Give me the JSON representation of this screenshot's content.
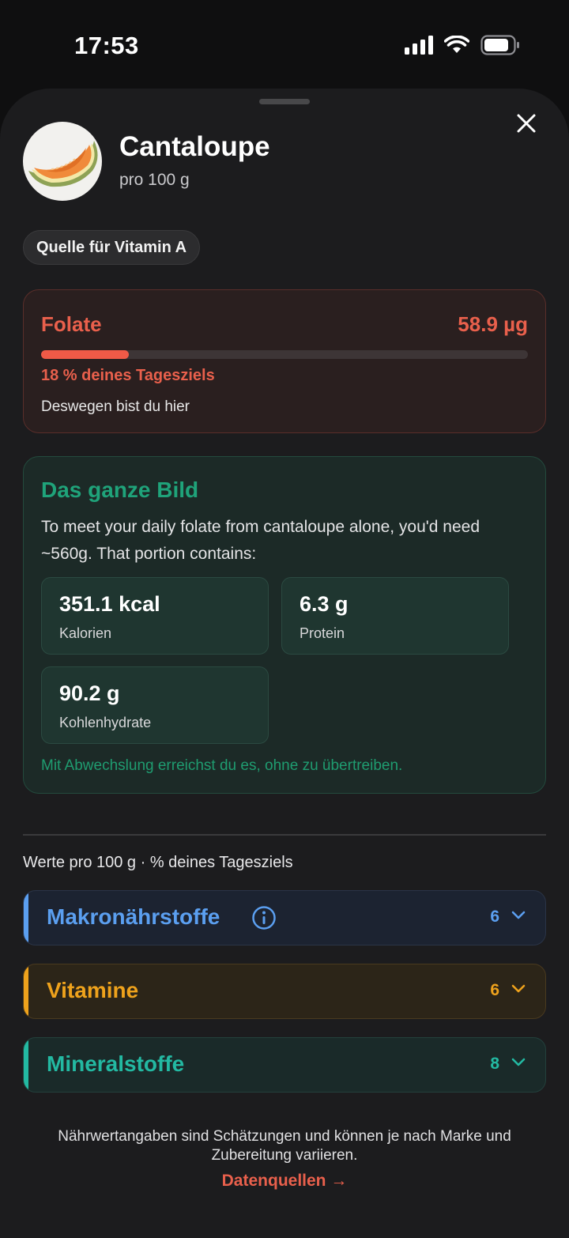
{
  "status_bar": {
    "time": "17:53"
  },
  "food": {
    "name": "Cantaloupe",
    "serving": "pro 100 g",
    "image_icon": "cantaloupe-slice"
  },
  "source_chip": "Quelle für Vitamin A",
  "focus_nutrient": {
    "name": "Folate",
    "value": "58.9 µg",
    "percent_text": "18 % deines Tagesziels",
    "progress": 0.18,
    "note": "Deswegen bist du hier",
    "color": "#e9604c"
  },
  "big_picture": {
    "title": "Das ganze Bild",
    "description": "To meet your daily folate from cantaloupe alone, you'd need ~560g. That portion contains:",
    "stats": [
      {
        "value": "351.1 kcal",
        "label": "Kalorien"
      },
      {
        "value": "6.3 g",
        "label": "Protein"
      },
      {
        "value": "90.2 g",
        "label": "Kohlenhydrate"
      }
    ],
    "footer": "Mit Abwechslung erreichst du es, ohne zu übertreiben.",
    "color": "#1fa37a"
  },
  "values_caption": "Werte pro 100 g · % deines Tagesziels",
  "sections": [
    {
      "label": "Makronährstoffe",
      "count": "6",
      "color": "#5b9ff0",
      "bg": "#1c2331",
      "border": "#2a3447",
      "has_info": true
    },
    {
      "label": "Vitamine",
      "count": "6",
      "color": "#eea21c",
      "bg": "#2c2518",
      "border": "#4a3a1f",
      "has_info": false
    },
    {
      "label": "Mineralstoffe",
      "count": "8",
      "color": "#23b9a2",
      "bg": "#1a2a29",
      "border": "#23403c",
      "has_info": false
    }
  ],
  "disclaimer": "Nährwertangaben sind Schätzungen und können je nach Marke und Zubereitung variieren.",
  "data_link": "Datenquellen →"
}
